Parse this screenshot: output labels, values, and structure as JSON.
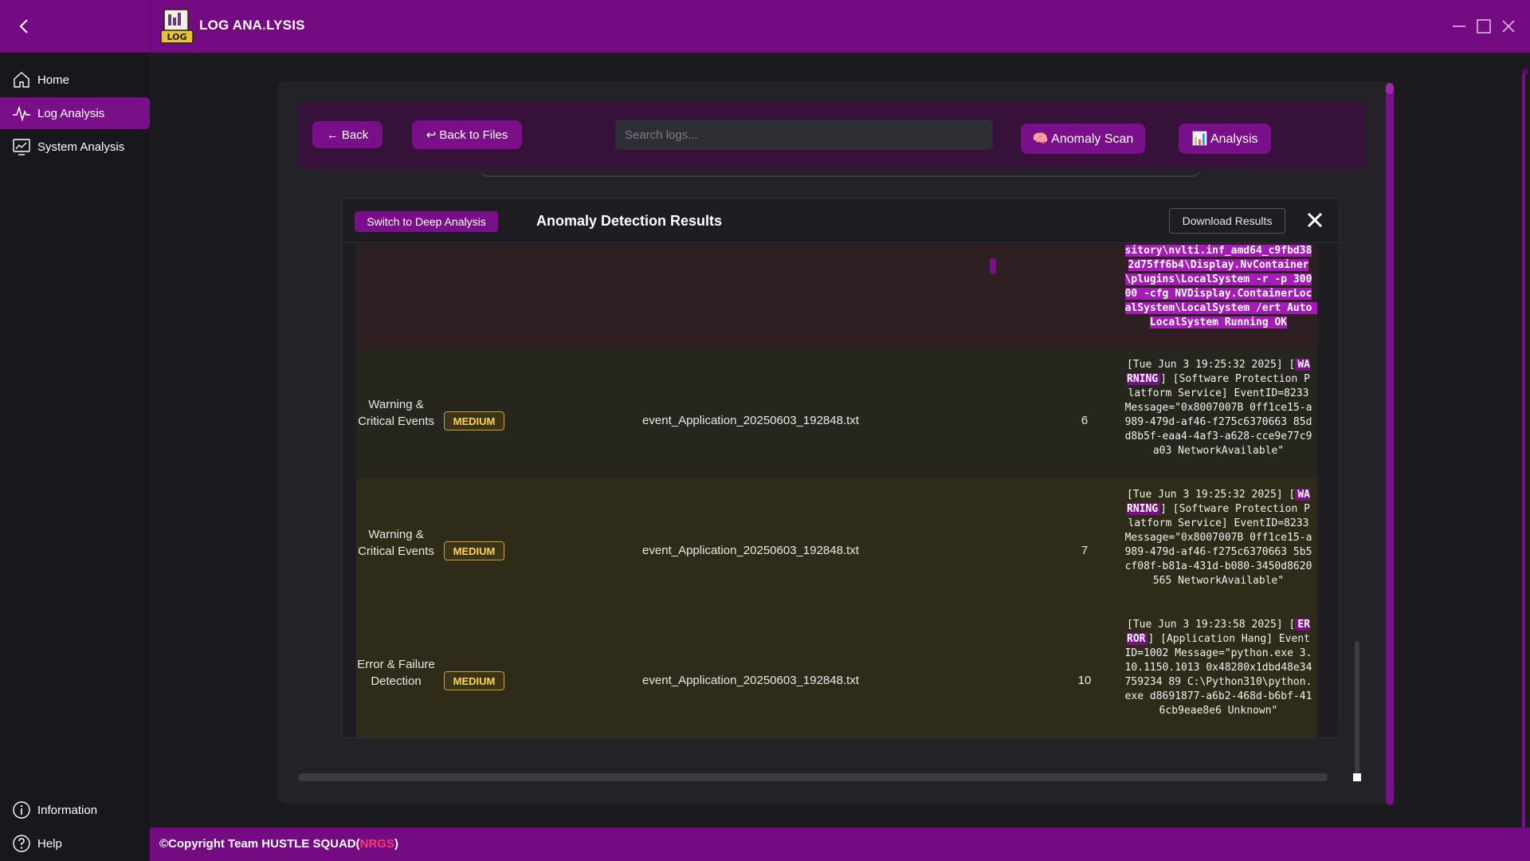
{
  "app": {
    "title_part1": "LOG ANA",
    "title_part2": "LYSIS",
    "logo_text": "LOG"
  },
  "sidebar": {
    "items": [
      {
        "label": "Home",
        "icon": "home-icon"
      },
      {
        "label": "Log Analysis",
        "icon": "pulse-icon",
        "active": true
      },
      {
        "label": "System Analysis",
        "icon": "monitor-chart-icon"
      }
    ],
    "bottom": [
      {
        "label": "Information",
        "icon": "info-icon"
      },
      {
        "label": "Help",
        "icon": "help-icon"
      }
    ]
  },
  "toolbar": {
    "back_label": "← Back",
    "back_files_label": "↩ Back to Files",
    "search_placeholder": "Search logs...",
    "anomaly_label": "🧠 Anomaly Scan",
    "analysis_label": "📊 Analysis"
  },
  "modal": {
    "switch_label": "Switch to Deep Analysis",
    "title": "Anomaly Detection Results",
    "download_label": "Download Results",
    "partial_row_message": "sitory\\nvlti.inf_amd64_c9fbd382d75ff6b4\\Display.NvContainer\\plugins\\LocalSystem -r -p 30000 -cfg NVDisplay.ContainerLocalSystem\\LocalSystem /ert Auto LocalSystem Running OK",
    "rows": [
      {
        "category": "Warning & Critical Events",
        "severity": "MEDIUM",
        "file": "event_Application_20250603_192848.txt",
        "line": "6",
        "msg_pre": "[Tue Jun 3 19:25:32 2025] [",
        "msg_tag": "WARNING",
        "msg_post": "] [Software Protection Platform Service] EventID=8233 Message=\"0x8007007B 0ff1ce15-a989-479d-af46-f275c6370663 85dd8b5f-eaa4-4af3-a628-cce9e77c9a03 NetworkAvailable\""
      },
      {
        "category": "Warning & Critical Events",
        "severity": "MEDIUM",
        "file": "event_Application_20250603_192848.txt",
        "line": "7",
        "msg_pre": "[Tue Jun 3 19:25:32 2025] [",
        "msg_tag": "WARNING",
        "msg_post": "] [Software Protection Platform Service] EventID=8233 Message=\"0x8007007B 0ff1ce15-a989-479d-af46-f275c6370663 5b5cf08f-b81a-431d-b080-3450d8620565 NetworkAvailable\""
      },
      {
        "category": "Error & Failure Detection",
        "severity": "MEDIUM",
        "file": "event_Application_20250603_192848.txt",
        "line": "10",
        "msg_pre": "[Tue Jun 3 19:23:58 2025] [",
        "msg_tag": "ERROR",
        "msg_post": "] [Application Hang] EventID=1002 Message=\"python.exe 3.10.1150.1013 0x48280x1dbd48e34759234 89 C:\\Python310\\python.exe d8691877-a6b2-468d-b6bf-416cb9eae8e6 Unknown\""
      }
    ]
  },
  "footer": {
    "text": "©Copyright Team HUSTLE SQUAD(",
    "nrgs": "NRGS",
    "close_paren": ")"
  },
  "colors": {
    "brand_purple": "#740b82",
    "accent_purple": "#7a1089",
    "medium_badge": "#ffd44d",
    "nrgs_red": "#ff3a6e"
  }
}
